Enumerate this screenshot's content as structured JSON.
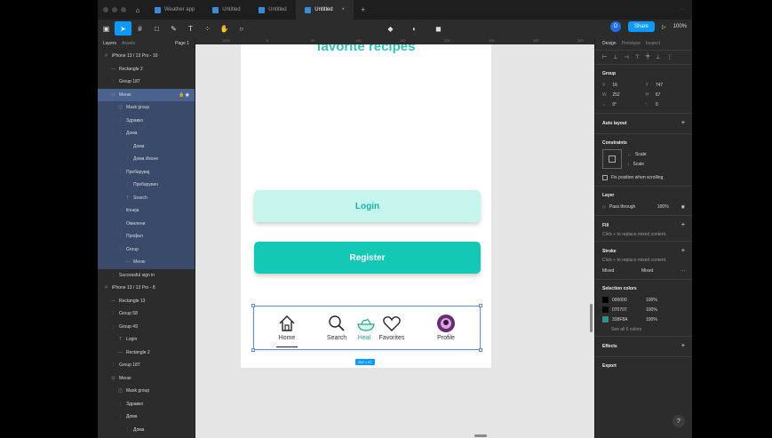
{
  "tabs": [
    {
      "label": "Weather app",
      "active": false
    },
    {
      "label": "Untitled",
      "active": false
    },
    {
      "label": "Untitled",
      "active": false
    },
    {
      "label": "Untitled",
      "active": true
    }
  ],
  "toolbar": {
    "share_label": "Share",
    "avatar_initial": "D",
    "zoom": "100%"
  },
  "left_panel": {
    "tab_layers": "Layers",
    "tab_assets": "Assets",
    "page": "Page 1",
    "layers": [
      {
        "indent": 0,
        "icon": "#",
        "label": "iPhone 13 / 13 Pro - 10",
        "style": ""
      },
      {
        "indent": 1,
        "icon": "—",
        "label": "Rectangle 2",
        "style": ""
      },
      {
        "indent": 1,
        "icon": "⋮",
        "label": "Group 187",
        "style": ""
      },
      {
        "indent": 1,
        "icon": "⊡",
        "label": "Меню",
        "style": "row",
        "lock": true
      },
      {
        "indent": 2,
        "icon": "◫",
        "label": "Mask group",
        "style": "block"
      },
      {
        "indent": 2,
        "icon": "⋮",
        "label": "Здравко",
        "style": "block"
      },
      {
        "indent": 2,
        "icon": "⋮",
        "label": "Дома",
        "style": "block"
      },
      {
        "indent": 3,
        "icon": "⋮",
        "label": "Дома",
        "style": "block"
      },
      {
        "indent": 3,
        "icon": "⋮",
        "label": "Дома Иконе",
        "style": "block"
      },
      {
        "indent": 2,
        "icon": "⋮",
        "label": "Пребарувај",
        "style": "block"
      },
      {
        "indent": 3,
        "icon": "⋮",
        "label": "Пребарувач",
        "style": "block"
      },
      {
        "indent": 3,
        "icon": "T",
        "label": "Search",
        "style": "block"
      },
      {
        "indent": 2,
        "icon": "⋮",
        "label": "linнеја",
        "style": "block"
      },
      {
        "indent": 2,
        "icon": "⋮",
        "label": "Омилени",
        "style": "block"
      },
      {
        "indent": 2,
        "icon": "⋮",
        "label": "Профил",
        "style": "block"
      },
      {
        "indent": 2,
        "icon": "⋮",
        "label": "Group",
        "style": "block"
      },
      {
        "indent": 3,
        "icon": "—",
        "label": "Меню",
        "style": "block"
      },
      {
        "indent": 1,
        "icon": "⋮",
        "label": "Successful sign in",
        "style": ""
      },
      {
        "indent": 0,
        "icon": "#",
        "label": "iPhone 13 / 13 Pro - 8",
        "style": ""
      },
      {
        "indent": 1,
        "icon": "—",
        "label": "Rectangle 13",
        "style": ""
      },
      {
        "indent": 1,
        "icon": "⋮",
        "label": "Group 58",
        "style": ""
      },
      {
        "indent": 1,
        "icon": "⋮",
        "label": "Group 49",
        "style": ""
      },
      {
        "indent": 2,
        "icon": "T",
        "label": "Login",
        "style": ""
      },
      {
        "indent": 2,
        "icon": "—",
        "label": "Rectangle 2",
        "style": ""
      },
      {
        "indent": 1,
        "icon": "⋮",
        "label": "Group 187",
        "style": ""
      },
      {
        "indent": 1,
        "icon": "⊡",
        "label": "Меню",
        "style": ""
      },
      {
        "indent": 2,
        "icon": "◫",
        "label": "Mask group",
        "style": ""
      },
      {
        "indent": 2,
        "icon": "⋮",
        "label": "Здравко",
        "style": ""
      },
      {
        "indent": 2,
        "icon": "⋮",
        "label": "Дома",
        "style": ""
      },
      {
        "indent": 3,
        "icon": "⋮",
        "label": "Дома",
        "style": ""
      }
    ]
  },
  "canvas": {
    "ruler": [
      "1200",
      "0",
      "50",
      "100",
      "150",
      "200",
      "250",
      "300",
      "350"
    ],
    "title": "favorite recipes",
    "login_label": "Login",
    "register_label": "Register",
    "nav": {
      "home": "Home",
      "search": "Search",
      "healthy": "Heal",
      "favorites": "Favorites",
      "profile": "Profile"
    },
    "size_badge": "252 × 67"
  },
  "right_panel": {
    "tab_design": "Design",
    "tab_prototype": "Prototype",
    "tab_inspect": "Inspect",
    "group_title": "Group",
    "x": "16",
    "y": "747",
    "w": "252",
    "h": "67",
    "rotation": "0°",
    "radius": "0",
    "auto_layout": "Auto layout",
    "constraints": "Constraints",
    "scale_h": "Scale",
    "scale_v": "Scale",
    "fix_position": "Fix position when scrolling",
    "layer_title": "Layer",
    "blend": "Pass through",
    "layer_opacity": "100%",
    "fill_title": "Fill",
    "fill_hint": "Click + to replace mixed content.",
    "stroke_title": "Stroke",
    "stroke_hint": "Click + to replace mixed content.",
    "stroke_mixed": "Mixed",
    "stroke_mixed2": "Mixed",
    "selection_colors": "Selection colors",
    "colors": [
      {
        "hex": "000000",
        "pct": "100%",
        "swatch": "#000000"
      },
      {
        "hex": "070707",
        "pct": "100%",
        "swatch": "#070707"
      },
      {
        "hex": "338F8A",
        "pct": "100%",
        "swatch": "#338F8A"
      }
    ],
    "see_all": "See all 6 colors",
    "effects": "Effects",
    "export": "Export"
  }
}
